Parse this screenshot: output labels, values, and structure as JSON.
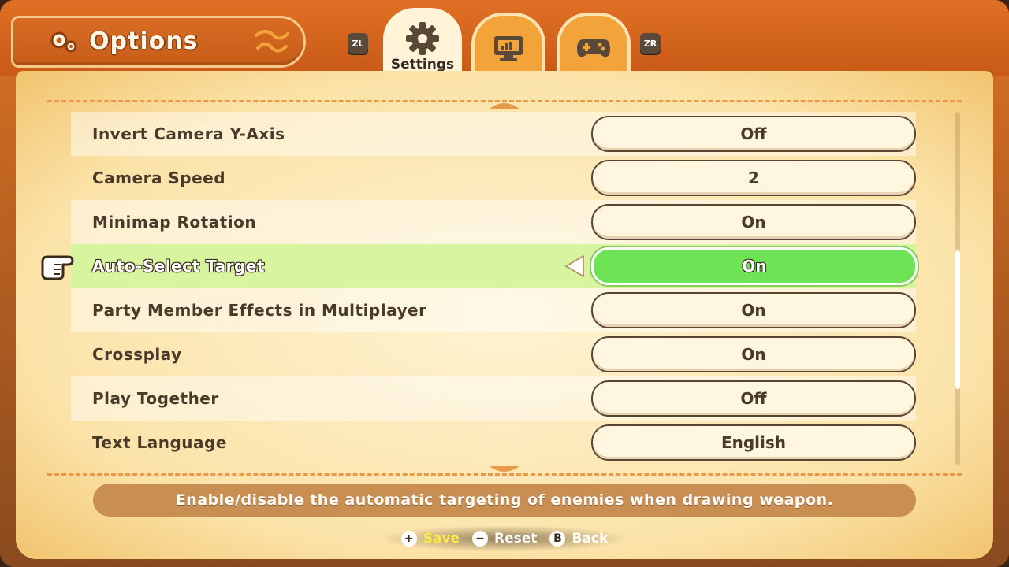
{
  "header": {
    "title": "Options",
    "tabs": [
      {
        "label": "Settings",
        "icon": "gear-icon",
        "active": true
      },
      {
        "label": "",
        "icon": "monitor-icon",
        "active": false
      },
      {
        "label": "",
        "icon": "gamepad-icon",
        "active": false
      }
    ],
    "hint_left": "ZL",
    "hint_right": "ZR"
  },
  "settings": [
    {
      "label": "Invert Camera Y-Axis",
      "value": "Off"
    },
    {
      "label": "Camera Speed",
      "value": "2"
    },
    {
      "label": "Minimap Rotation",
      "value": "On"
    },
    {
      "label": "Auto-Select Target",
      "value": "On",
      "selected": true
    },
    {
      "label": "Party Member Effects in Multiplayer",
      "value": "On"
    },
    {
      "label": "Crossplay",
      "value": "On"
    },
    {
      "label": "Play Together",
      "value": "Off"
    },
    {
      "label": "Text Language",
      "value": "English"
    }
  ],
  "description": "Enable/disable the automatic targeting of enemies when drawing weapon.",
  "footer": {
    "save": {
      "button": "+",
      "label": "Save"
    },
    "reset": {
      "button": "−",
      "label": "Reset"
    },
    "back": {
      "button": "B",
      "label": "Back"
    }
  },
  "colors": {
    "accent_orange": "#d56f22",
    "selected_row": "#d7f49e",
    "selected_value": "#6ee356",
    "save_yellow": "#ffe94a"
  }
}
